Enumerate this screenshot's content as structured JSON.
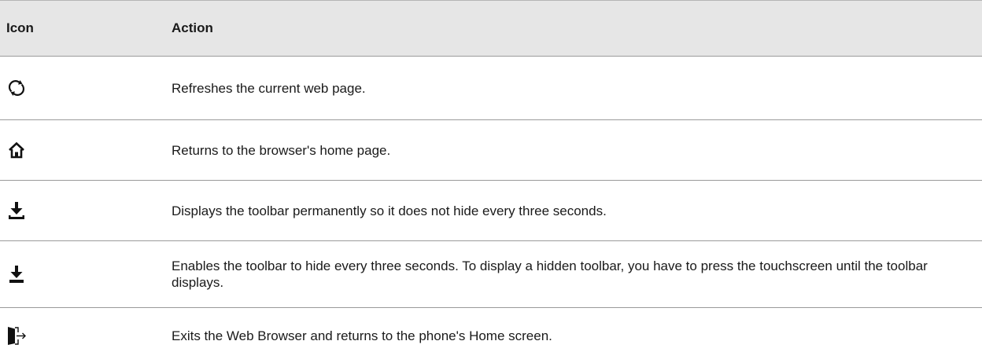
{
  "table": {
    "headers": {
      "icon": "Icon",
      "action": "Action"
    },
    "rows": [
      {
        "icon": "refresh-icon",
        "action": "Refreshes the current web page."
      },
      {
        "icon": "home-icon",
        "action": "Returns to the browser's home page."
      },
      {
        "icon": "pin-toolbar-icon",
        "action": "Displays the toolbar permanently so it does not hide every three seconds."
      },
      {
        "icon": "auto-hide-toolbar-icon",
        "action": "Enables the toolbar to hide every three seconds. To display a hidden toolbar, you have to press the touchscreen until the toolbar displays."
      },
      {
        "icon": "exit-icon",
        "action": "Exits the Web Browser and returns to the phone's Home screen."
      }
    ]
  }
}
